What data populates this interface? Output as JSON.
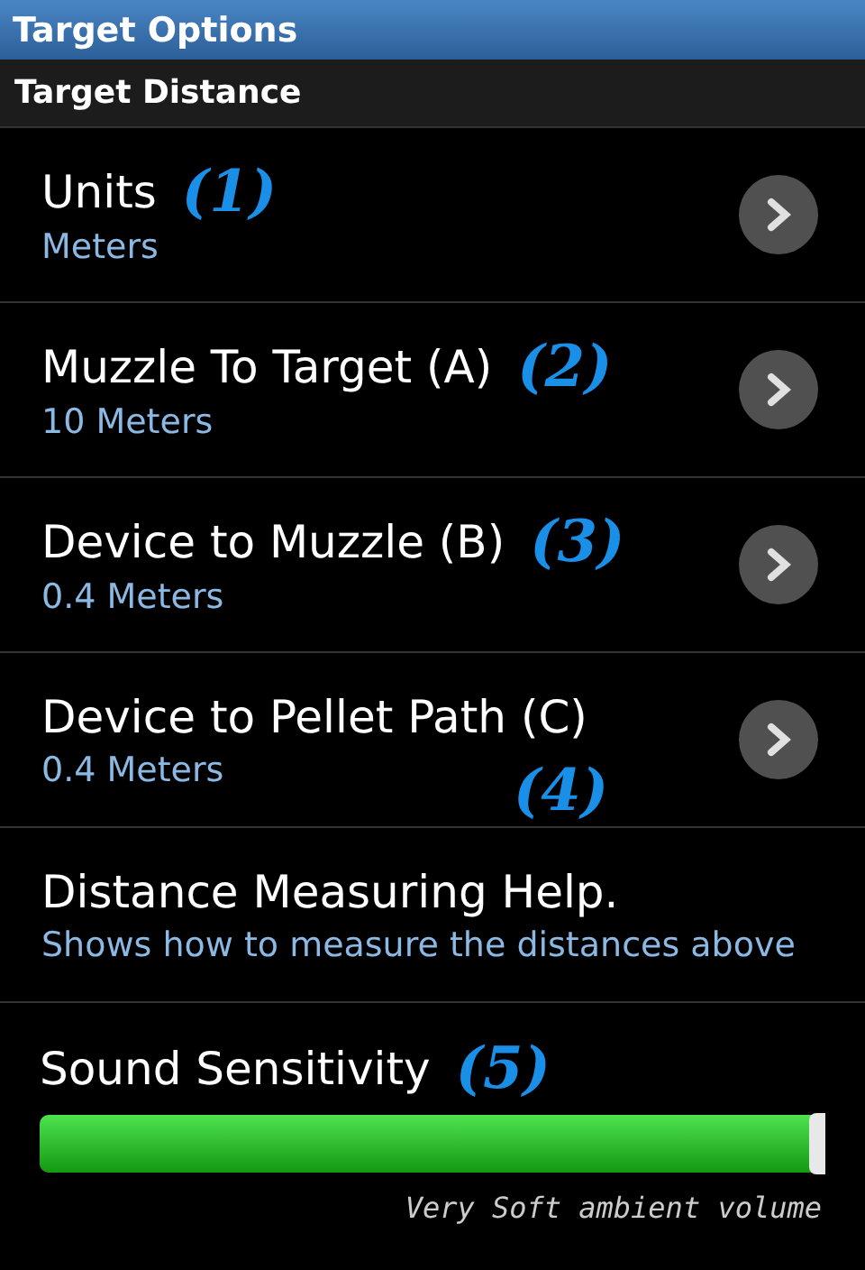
{
  "window": {
    "title": "Target Options"
  },
  "section": {
    "title": "Target Distance"
  },
  "items": [
    {
      "title": "Units",
      "summary": "Meters",
      "callout": "(1)",
      "callout_below": false,
      "has_arrow": true
    },
    {
      "title": "Muzzle To Target (A)",
      "summary": "10 Meters",
      "callout": "(2)",
      "callout_below": false,
      "has_arrow": true
    },
    {
      "title": "Device to Muzzle (B)",
      "summary": "0.4 Meters",
      "callout": "(3)",
      "callout_below": false,
      "has_arrow": true
    },
    {
      "title": "Device to Pellet Path (C)",
      "summary": "0.4 Meters",
      "callout": "(4)",
      "callout_below": true,
      "has_arrow": true
    },
    {
      "title": "Distance Measuring Help.",
      "summary": "Shows how to measure the distances above",
      "has_arrow": false
    }
  ],
  "sound": {
    "title": "Sound Sensitivity",
    "callout": "(5)",
    "level": 1.0,
    "caption": "Very Soft ambient volume"
  }
}
